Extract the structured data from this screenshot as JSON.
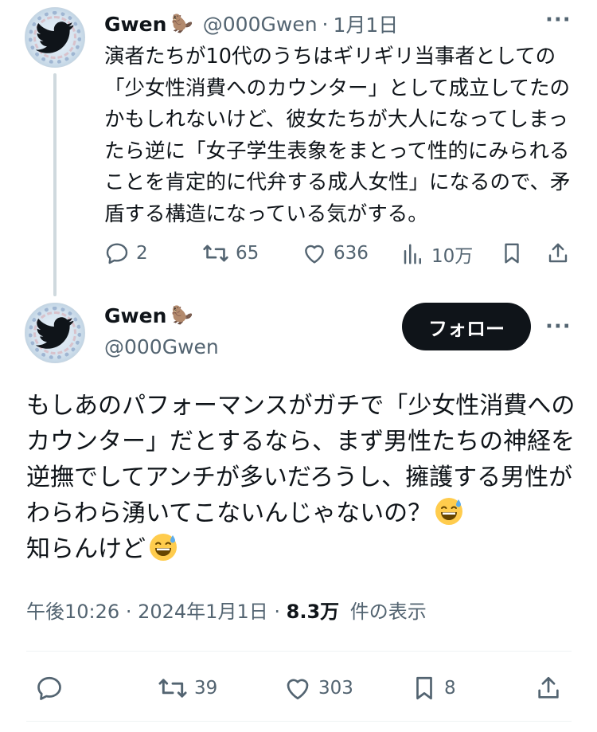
{
  "tweet1": {
    "author_name": "Gwen",
    "author_emoji": "🦫",
    "handle": "@000Gwen",
    "date": "1月1日",
    "separator": "·",
    "text": "演者たちが10代のうちはギリギリ当事者としての「少女性消費へのカウンター」として成立してたのかもしれないけど、彼女たちが大人になってしまったら逆に「女子学生表象をまとって性的にみられることを肯定的に代弁する成人女性」になるので、矛盾する構造になっている気がする。",
    "replies": "2",
    "retweets": "65",
    "likes": "636",
    "views": "10万",
    "more_label": "···"
  },
  "tweet2": {
    "author_name": "Gwen",
    "author_emoji": "🦫",
    "handle": "@000Gwen",
    "follow_label": "フォロー",
    "more_label": "···",
    "text_part1": "もしあのパフォーマンスがガチで「少女性消費へのカウンター」だとするなら、まず男性たちの神経を逆撫でしてアンチが多いだろうし、擁護する男性がわらわら湧いてこないんじゃないの？",
    "text_part2": "知らんけど",
    "emoji_name": "grinning-face-with-sweat",
    "time": "午後10:26",
    "date": "2024年1月1日",
    "separator": "·",
    "views_count": "8.3万",
    "views_label": "件の表示",
    "retweets": "39",
    "likes": "303",
    "bookmarks": "8"
  },
  "colors": {
    "text": "#0f1419",
    "muted": "#536471",
    "line": "#cfd9de",
    "divider": "#eff3f4",
    "button": "#0f1419"
  }
}
